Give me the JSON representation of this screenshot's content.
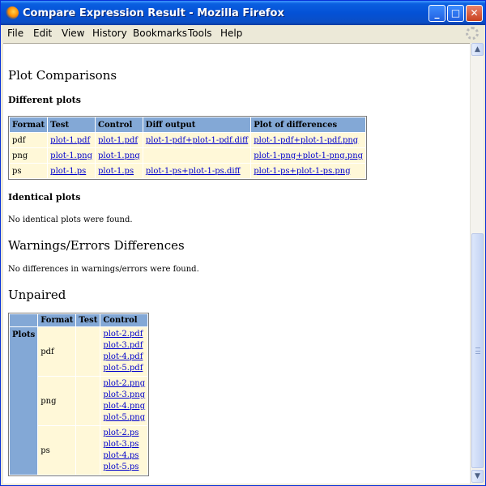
{
  "window": {
    "title": "Compare Expression Result - Mozilla Firefox",
    "icon": "firefox-icon"
  },
  "menubar": {
    "items": [
      "File",
      "Edit",
      "View",
      "History",
      "Bookmarks",
      "Tools",
      "Help"
    ]
  },
  "page": {
    "heading_plot_comparisons": "Plot Comparisons",
    "heading_different_plots": "Different plots",
    "diff_table": {
      "headers": [
        "Format",
        "Test",
        "Control",
        "Diff output",
        "Plot of differences"
      ],
      "rows": [
        [
          "pdf",
          "plot-1.pdf",
          "plot-1.pdf",
          "plot-1-pdf+plot-1-pdf.diff",
          "plot-1-pdf+plot-1-pdf.png"
        ],
        [
          "png",
          "plot-1.png",
          "plot-1.png",
          "",
          "plot-1-png+plot-1-png.png"
        ],
        [
          "ps",
          "plot-1.ps",
          "plot-1.ps",
          "plot-1-ps+plot-1-ps.diff",
          "plot-1-ps+plot-1-ps.png"
        ]
      ]
    },
    "heading_identical_plots": "Identical plots",
    "identical_msg": "No identical plots were found.",
    "heading_warnings": "Warnings/Errors Differences",
    "warnings_msg": "No differences in warnings/errors were found.",
    "heading_unpaired": "Unpaired",
    "unpaired_table": {
      "headers": [
        "Format",
        "Test",
        "Control"
      ],
      "row_label": "Plots",
      "groups": [
        {
          "format": "pdf",
          "test": "",
          "control": [
            "plot-2.pdf",
            "plot-3.pdf",
            "plot-4.pdf",
            "plot-5.pdf"
          ]
        },
        {
          "format": "png",
          "test": "",
          "control": [
            "plot-2.png",
            "plot-3.png",
            "plot-4.png",
            "plot-5.png"
          ]
        },
        {
          "format": "ps",
          "test": "",
          "control": [
            "plot-2.ps",
            "plot-3.ps",
            "plot-4.ps",
            "plot-5.ps"
          ]
        }
      ]
    }
  },
  "colors": {
    "header_bg": "#83a8d6",
    "cell_bg": "#fff8d8",
    "link": "#0000cc",
    "titlebar": "#0451d6"
  }
}
